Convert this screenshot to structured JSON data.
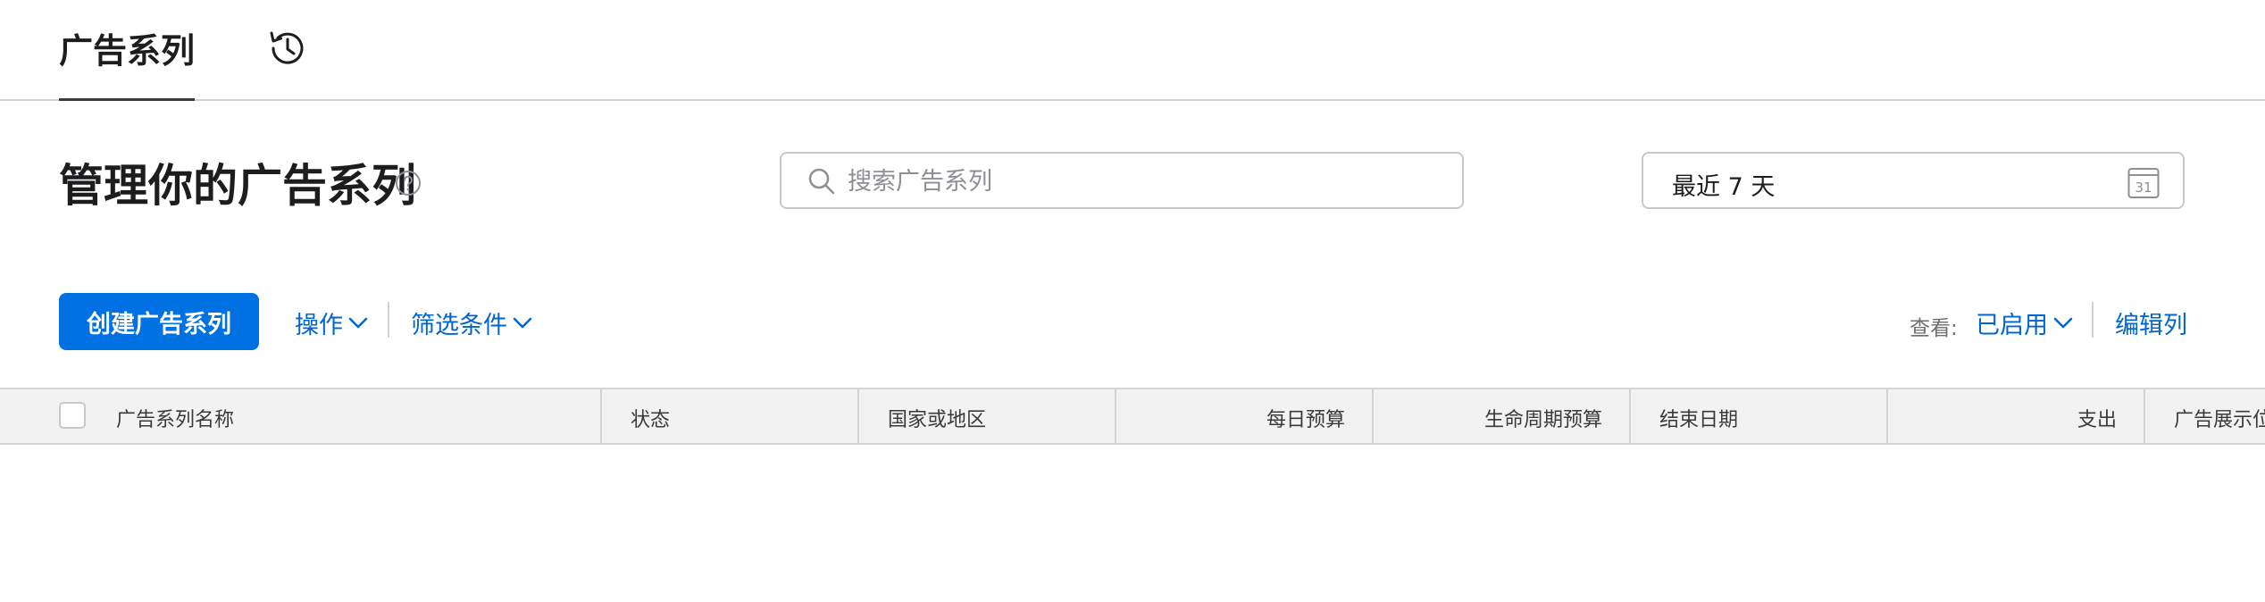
{
  "top_tabs": {
    "active_label": "广告系列",
    "history_icon": "history-clock-icon"
  },
  "header": {
    "title": "管理你的广告系列",
    "help_icon": "question-circle-icon"
  },
  "search": {
    "placeholder": "搜索广告系列",
    "value": ""
  },
  "date_range": {
    "label": "最近 7 天",
    "calendar_day": "31"
  },
  "toolbar": {
    "create_label": "创建广告系列",
    "actions_label": "操作",
    "filters_label": "筛选条件",
    "view_prefix": "查看:",
    "view_value": "已启用",
    "edit_columns_label": "编辑列"
  },
  "table": {
    "columns": [
      "广告系列名称",
      "状态",
      "国家或地区",
      "每日预算",
      "生命周期预算",
      "结束日期",
      "支出",
      "广告展示位"
    ]
  },
  "colors": {
    "accent": "#0071e3",
    "link": "#0066cc",
    "header_bg": "#f2f2f2",
    "border": "#d2d2d7"
  }
}
